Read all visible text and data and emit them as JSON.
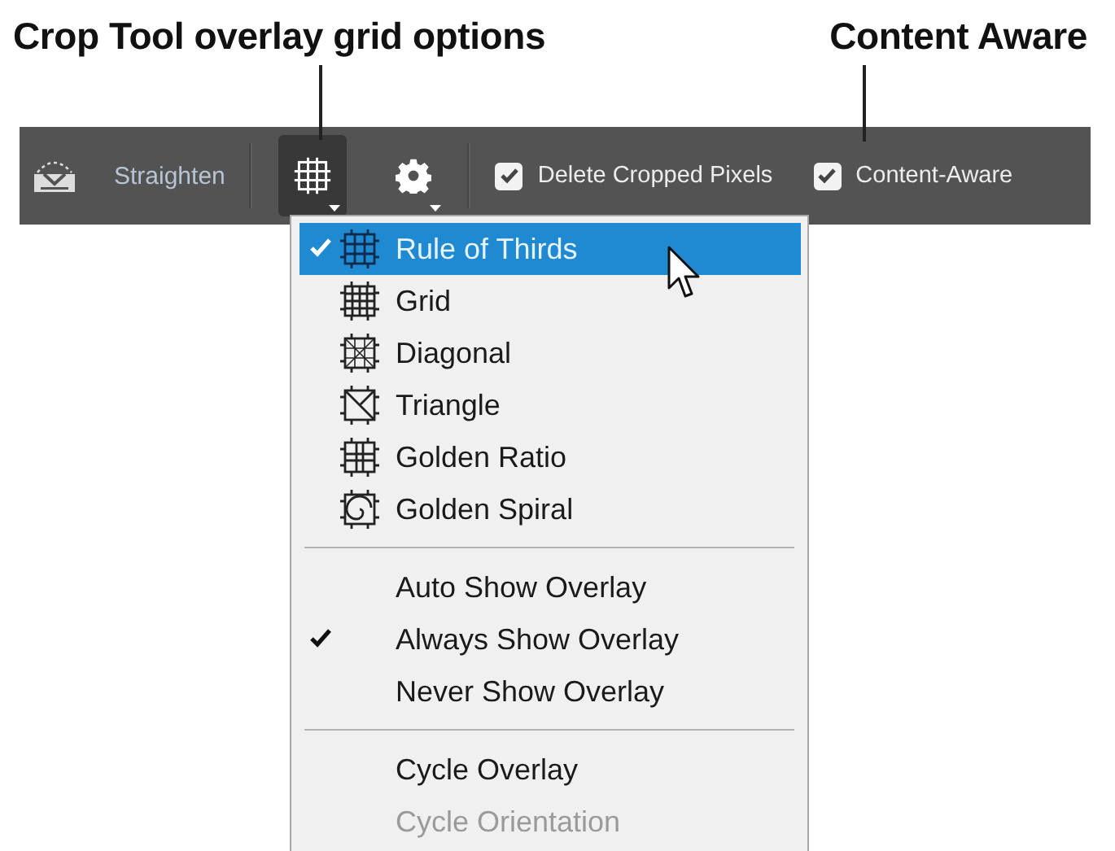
{
  "callouts": [
    {
      "text": "Crop Tool overlay grid options"
    },
    {
      "text": "Content Aware"
    }
  ],
  "toolbar": {
    "straighten_label": "Straighten",
    "tool_buttons": [
      {
        "kind": "overlay",
        "selected": true
      },
      {
        "kind": "settings",
        "selected": false
      }
    ],
    "options": [
      {
        "label": "Delete Cropped Pixels",
        "checked": true
      },
      {
        "label": "Content-Aware",
        "checked": true
      }
    ]
  },
  "overlay_menu": {
    "sections": [
      {
        "items": [
          {
            "label": "Rule of Thirds",
            "kind": "thirds",
            "checked": true,
            "selected": true,
            "disabled": false
          },
          {
            "label": "Grid",
            "kind": "grid",
            "checked": false,
            "selected": false,
            "disabled": false
          },
          {
            "label": "Diagonal",
            "kind": "diagonal",
            "checked": false,
            "selected": false,
            "disabled": false
          },
          {
            "label": "Triangle",
            "kind": "triangle",
            "checked": false,
            "selected": false,
            "disabled": false
          },
          {
            "label": "Golden Ratio",
            "kind": "golden-ratio",
            "checked": false,
            "selected": false,
            "disabled": false
          },
          {
            "label": "Golden Spiral",
            "kind": "spiral",
            "checked": false,
            "selected": false,
            "disabled": false
          }
        ]
      },
      {
        "items": [
          {
            "label": "Auto Show Overlay",
            "kind": "plain",
            "checked": false,
            "selected": false,
            "disabled": false
          },
          {
            "label": "Always Show Overlay",
            "kind": "plain",
            "checked": true,
            "selected": false,
            "disabled": false
          },
          {
            "label": "Never Show Overlay",
            "kind": "plain",
            "checked": false,
            "selected": false,
            "disabled": false
          }
        ]
      },
      {
        "items": [
          {
            "label": "Cycle Overlay",
            "kind": "plain",
            "checked": false,
            "selected": false,
            "disabled": false
          },
          {
            "label": "Cycle Orientation",
            "kind": "plain",
            "checked": false,
            "selected": false,
            "disabled": true
          }
        ]
      }
    ]
  }
}
